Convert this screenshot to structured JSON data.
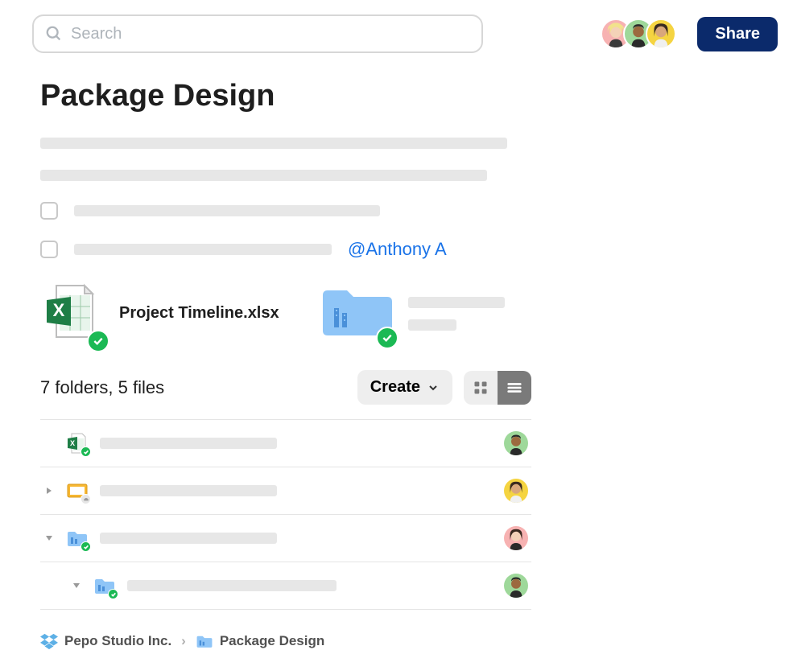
{
  "search": {
    "placeholder": "Search"
  },
  "header": {
    "share_label": "Share",
    "avatars": [
      {
        "bg": "#f7b2b2",
        "skin": "#f4d2b8",
        "hair": "#f2e28c"
      },
      {
        "bg": "#9ed89a",
        "skin": "#9c6a3f",
        "hair": "#2a2a2a"
      },
      {
        "bg": "#f5d441",
        "skin": "#d9a77c",
        "hair": "#3a2a20"
      }
    ]
  },
  "page": {
    "title": "Package Design",
    "mention": "@Anthony A"
  },
  "previews": {
    "file_label": "Project Timeline.xlsx"
  },
  "summary": {
    "counts": "7 folders, 5 files",
    "create_label": "Create"
  },
  "rows": [
    {
      "type": "excel",
      "avatar_bg": "#9ed89a",
      "avatar_skin": "#9c6a3f",
      "avatar_hair": "#2a2a2a"
    },
    {
      "type": "slides",
      "avatar_bg": "#f5d441",
      "avatar_skin": "#d9a77c",
      "avatar_hair": "#3a2a20"
    },
    {
      "type": "folder",
      "avatar_bg": "#f7b2b2",
      "avatar_skin": "#f4d2b8",
      "avatar_hair": "#3a2a20"
    },
    {
      "type": "folder",
      "avatar_bg": "#9ed89a",
      "avatar_skin": "#9c6a3f",
      "avatar_hair": "#2a2a2a"
    }
  ],
  "breadcrumb": {
    "root": "Pepo Studio Inc.",
    "current": "Package Design"
  }
}
